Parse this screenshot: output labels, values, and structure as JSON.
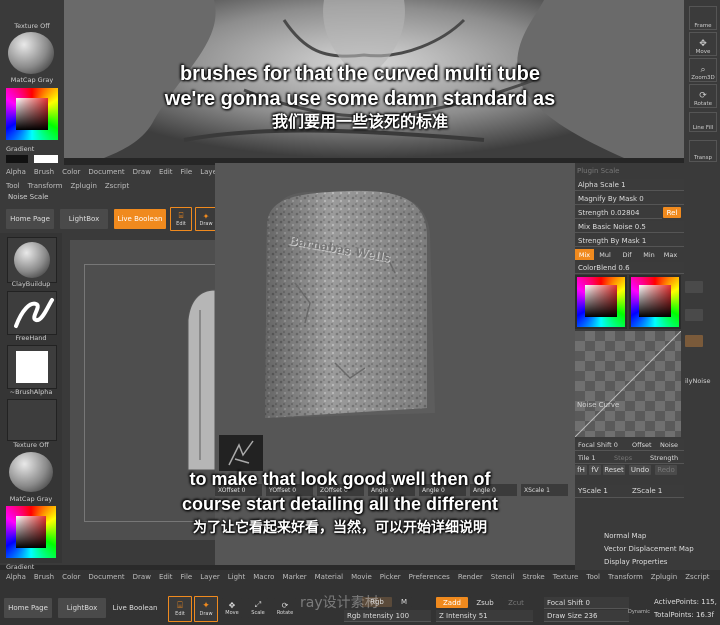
{
  "subtitles": {
    "top_en_1": "brushes for that the curved multi tube",
    "top_en_2": "we're gonna use some damn standard as",
    "top_zh": "我们要用一些该死的标准",
    "bottom_en_1": "to make that look good well then of",
    "bottom_en_2": "course start detailing all the different",
    "bottom_zh": "为了让它看起来好看，当然，可以开始详细说明"
  },
  "top_left": {
    "texture_label": "Texture Off",
    "matcap_label": "MatCap Gray",
    "gradient_label": "Gradient"
  },
  "right_top_tools": {
    "frame": "Frame",
    "move": "Move",
    "zoom3d": "Zoom3D",
    "rotate": "Rotate",
    "linefill": "Line Fill",
    "transp": "Transp"
  },
  "mid_menu": [
    "Alpha",
    "Brush",
    "Color",
    "Document",
    "Draw",
    "Edit",
    "File",
    "Layer"
  ],
  "mid_menu2": [
    "Tool",
    "Transform",
    "Zplugin",
    "Zscript"
  ],
  "noise_scale_label": "Noise Scale",
  "mid_toolbar": {
    "home_page": "Home Page",
    "lightbox": "LightBox",
    "live_boolean": "Live Boolean",
    "edit": "Edit",
    "draw": "Draw"
  },
  "left_shelf": {
    "claybuildup": "ClayBuildup",
    "freehand": "FreeHand",
    "brushalpha": "~BrushAlpha",
    "texture_off": "Texture Off",
    "matcap_gray": "MatCap Gray",
    "gradient": "Gradient"
  },
  "tombstone_text": "Barnabas Wells",
  "noise_panel": {
    "plugin_scale": "Plugin Scale",
    "alpha_scale": "Alpha Scale 1",
    "magnify_by_mask": "Magnify By Mask 0",
    "strength": "Strength 0.02804",
    "rel": "Rel",
    "mix_basic_noise": "Mix Basic Noise 0.5",
    "strength_by_mask": "Strength By Mask 1",
    "mix_tabs": [
      "Mix",
      "Mul",
      "Dif",
      "Min",
      "Max"
    ],
    "color_blend": "ColorBlend 0.6",
    "noise_curve": "Noise Curve",
    "focal_shift": "Focal Shift 0",
    "offset": "Offset",
    "noise": "Noise",
    "tile": "Tile 1",
    "steps": "Steps",
    "strength2": "Strength",
    "fh": "fH",
    "fv": "fV",
    "reset": "Reset",
    "undo": "Undo",
    "redo": "Redo",
    "yscale": "YScale 1",
    "zscale": "ZScale 1",
    "noise_side": "ilyNoise"
  },
  "lower_sliders": [
    "XOffset 0",
    "YOffset 0",
    "ZOffset 0",
    "Angle 0",
    "Angle 0",
    "Angle 0",
    "XScale 1"
  ],
  "right_list": {
    "normal_map": "Normal Map",
    "vector_displacement_map": "Vector Displacement Map",
    "display_properties": "Display Properties"
  },
  "bottom_menu": [
    "Alpha",
    "Brush",
    "Color",
    "Document",
    "Draw",
    "Edit",
    "File",
    "Layer",
    "Light",
    "Macro",
    "Marker",
    "Material",
    "Movie",
    "Picker",
    "Preferences",
    "Render",
    "Stencil",
    "Stroke",
    "Texture",
    "Tool",
    "Transform",
    "Zplugin",
    "Zscript"
  ],
  "bottom_toolbar": {
    "home_page": "Home Page",
    "lightbox": "LightBox",
    "live_boolean": "Live Boolean",
    "edit": "Edit",
    "draw": "Draw",
    "move": "Move",
    "scale": "Scale",
    "rotate": "Rotate",
    "rgb": "Rgb",
    "m": "M",
    "rgb_intensity": "Rgb Intensity 100",
    "zadd": "Zadd",
    "zsub": "Zsub",
    "zcut": "Zcut",
    "z_intensity": "Z Intensity 51",
    "focal_shift": "Focal Shift 0",
    "draw_size": "Draw Size 236",
    "dynamic": "Dynamic",
    "active_points": "ActivePoints: 115,",
    "total_points": "TotalPoints: 16.3f"
  },
  "watermark": "ray设计素材"
}
